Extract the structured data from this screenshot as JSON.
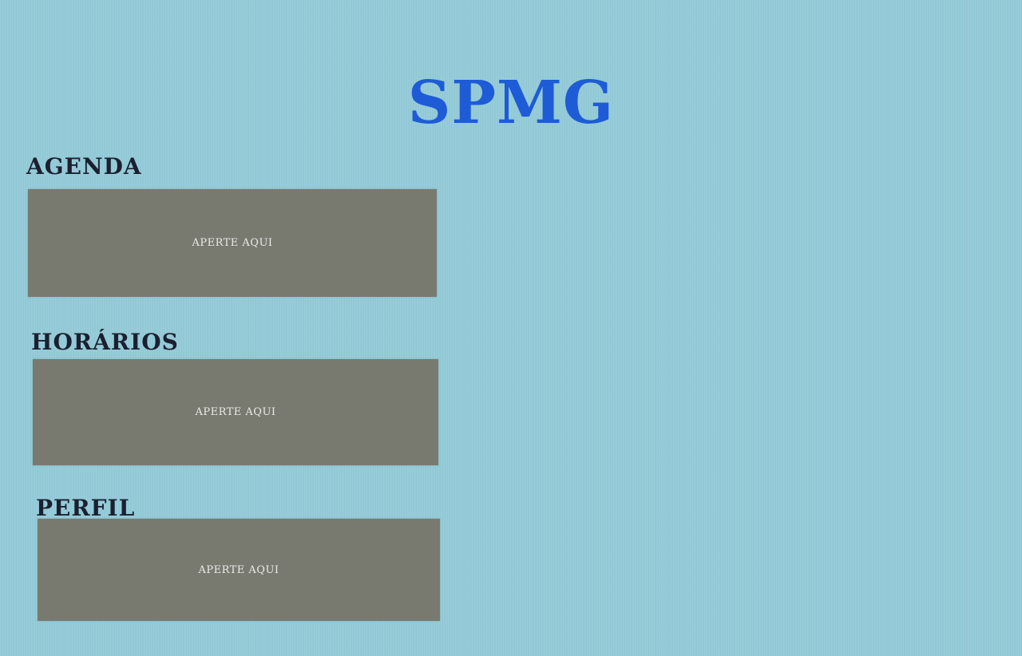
{
  "app": {
    "title": "SPMG"
  },
  "sections": [
    {
      "heading": "AGENDA",
      "button_label": "APERTE AQUI"
    },
    {
      "heading": "HORÁRIOS",
      "button_label": "APERTE AQUI"
    },
    {
      "heading": "PERFIL",
      "button_label": "APERTE AQUI"
    }
  ],
  "colors": {
    "background": "#93cbd8",
    "title": "#1e5bd6",
    "heading": "#1b2030",
    "button_bg": "#787a70",
    "button_text": "#e9ebe6"
  }
}
